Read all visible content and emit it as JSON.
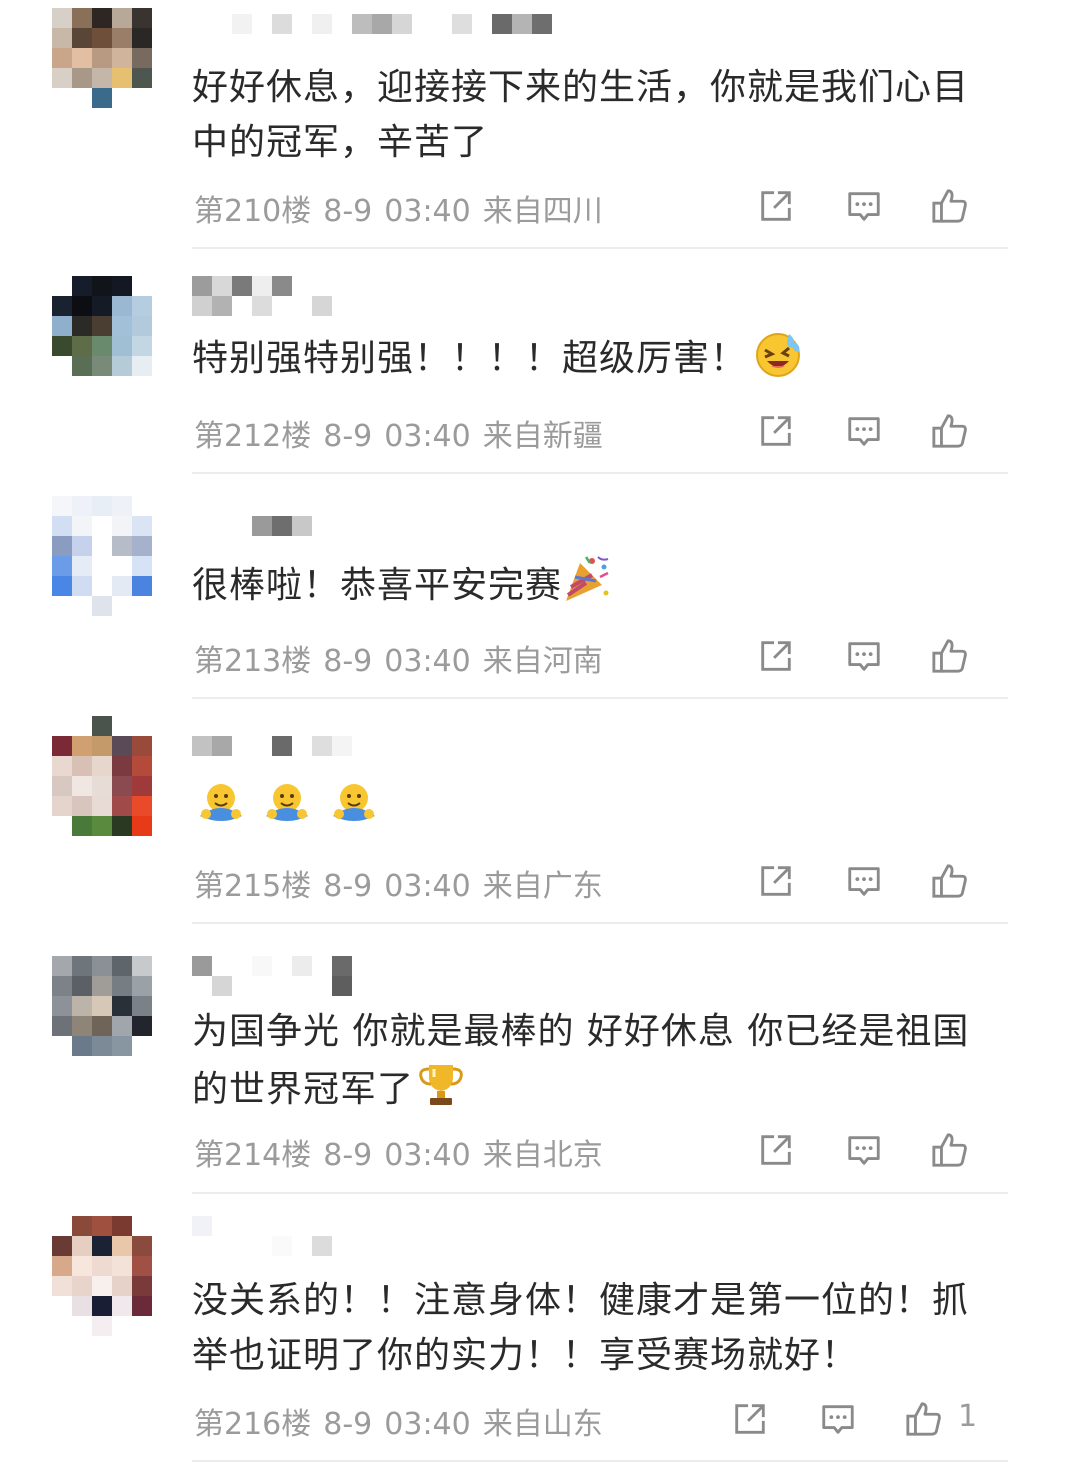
{
  "colors": {
    "text": "#2a2a2a",
    "meta": "#9b9b9b",
    "divider": "#ededed",
    "icon": "#8a8a8a"
  },
  "comments": [
    {
      "text": "好好休息，迎接接下来的生活，你就是我们心目中的冠军，辛苦了",
      "emoji": "",
      "floor": "第210楼",
      "date": "8-9",
      "time": "03:40",
      "location": "来自四川",
      "likes": ""
    },
    {
      "text": "特别强特别强！！！！超级厉害！",
      "emoji": "crying-laughing-emoji",
      "floor": "第212楼",
      "date": "8-9",
      "time": "03:40",
      "location": "来自新疆",
      "likes": ""
    },
    {
      "text": "很棒啦！恭喜平安完赛",
      "emoji": "party-popper-emoji",
      "floor": "第213楼",
      "date": "8-9",
      "time": "03:40",
      "location": "来自河南",
      "likes": ""
    },
    {
      "text": "",
      "emoji": "hug-emoji x3",
      "floor": "第215楼",
      "date": "8-9",
      "time": "03:40",
      "location": "来自广东",
      "likes": ""
    },
    {
      "text": "为国争光 你就是最棒的 好好休息 你已经是祖国的世界冠军了",
      "emoji": "trophy-emoji",
      "floor": "第214楼",
      "date": "8-9",
      "time": "03:40",
      "location": "来自北京",
      "likes": ""
    },
    {
      "text": "没关系的！！注意身体！健康才是第一位的！抓举也证明了你的实力！！享受赛场就好！",
      "emoji": "",
      "floor": "第216楼",
      "date": "8-9",
      "time": "03:40",
      "location": "来自山东",
      "likes": "1"
    }
  ],
  "icons": {
    "share": "share-icon",
    "reply": "comment-icon",
    "like": "thumbs-up-icon"
  }
}
